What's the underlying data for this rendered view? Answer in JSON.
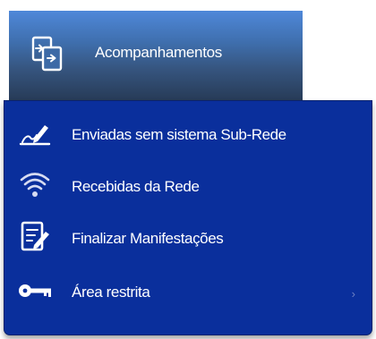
{
  "header": {
    "title": "Acompanhamentos",
    "icon": "documents-transfer-icon"
  },
  "menu": {
    "items": [
      {
        "label": "Enviadas sem sistema Sub-Rede",
        "icon": "pen-writing-icon"
      },
      {
        "label": "Recebidas da Rede",
        "icon": "wifi-icon"
      },
      {
        "label": "Finalizar Manifestações",
        "icon": "edit-document-icon"
      },
      {
        "label": "Área restrita",
        "icon": "key-icon",
        "has_submenu": true
      }
    ]
  },
  "colors": {
    "menu_background": "#0a2f9c",
    "tab_top": "#4f88d9",
    "tab_bottom": "#273b57",
    "text": "#ffffff"
  }
}
